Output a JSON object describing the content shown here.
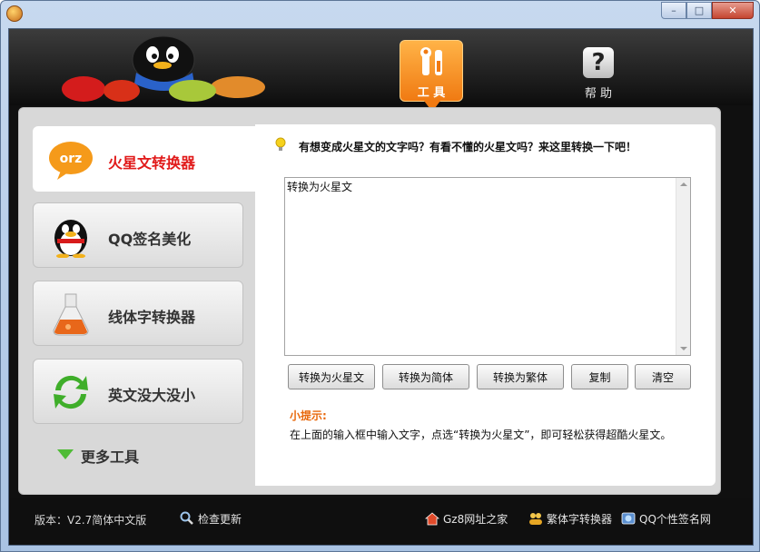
{
  "window": {
    "minimize": "–",
    "maximize": "□",
    "close": "✕"
  },
  "header": {
    "tabs": [
      {
        "label": "工 具",
        "icon": "tools-icon",
        "active": true
      },
      {
        "label": "帮 助",
        "icon": "help-icon",
        "active": false
      }
    ],
    "help_symbol": "?"
  },
  "sidebar": {
    "items": [
      {
        "label": "火星文转换器",
        "icon": "orz-bubble-icon",
        "active": true
      },
      {
        "label": "QQ签名美化",
        "icon": "penguin-icon",
        "active": false
      },
      {
        "label": "线体字转换器",
        "icon": "flask-icon",
        "active": false
      },
      {
        "label": "英文没大没小",
        "icon": "refresh-arrows-icon",
        "active": false
      }
    ],
    "more_label": "更多工具"
  },
  "panel": {
    "tip": "有想变成火星文的文字吗？有看不懂的火星文吗？来这里转换一下吧！",
    "input_value": "转换为火星文",
    "buttons": {
      "to_martian": "转换为火星文",
      "to_simplified": "转换为简体",
      "to_traditional": "转换为繁体",
      "copy": "复制",
      "clear": "清空"
    },
    "hint_title": "小提示:",
    "hint_text": "在上面的输入框中输入文字，点选“转换为火星文”，即可轻松获得超酷火星文。"
  },
  "footer": {
    "version": "版本：V2.7简体中文版",
    "check_update": "检查更新",
    "links": [
      "Gz8网址之家",
      "繁体字转换器",
      "QQ个性签名网"
    ]
  },
  "colors": {
    "accent": "#f07a12",
    "active_nav_text": "#e11a1a",
    "hint_title": "#e8680c"
  }
}
